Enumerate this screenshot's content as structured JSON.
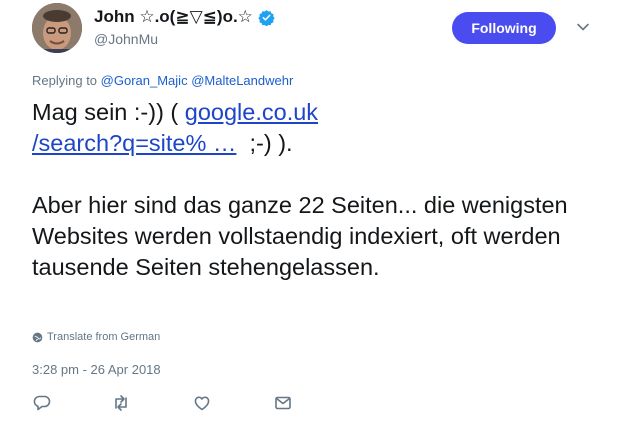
{
  "user": {
    "display_name": "John ☆.o(≧▽≦)o.☆",
    "handle": "@JohnMu",
    "follow_label": "Following"
  },
  "replying": {
    "prefix": "Replying to",
    "mentions": [
      "@Goran_Majic",
      "@MalteLandwehr"
    ]
  },
  "tweet": {
    "text_before_link": "Mag sein :-)) (",
    "link_line1": "google.co.uk",
    "link_line2": "/search?q=site% …",
    "text_after_link": ";-) ).",
    "paragraph2": "Aber hier sind das ganze 22 Seiten... die wenigsten Websites werden vollstaendig indexiert, oft werden tausende Seiten stehengelassen."
  },
  "translate_label": "Translate from German",
  "timestamp": "3:28 pm - 26 Apr 2018",
  "actions": [
    "reply-icon",
    "retweet-icon",
    "like-icon",
    "message-icon"
  ],
  "colors": {
    "follow_button": "#4a4cf0",
    "link": "#1b5fcc",
    "meta_text": "#657786",
    "verified_badge": "#1da1f2"
  }
}
